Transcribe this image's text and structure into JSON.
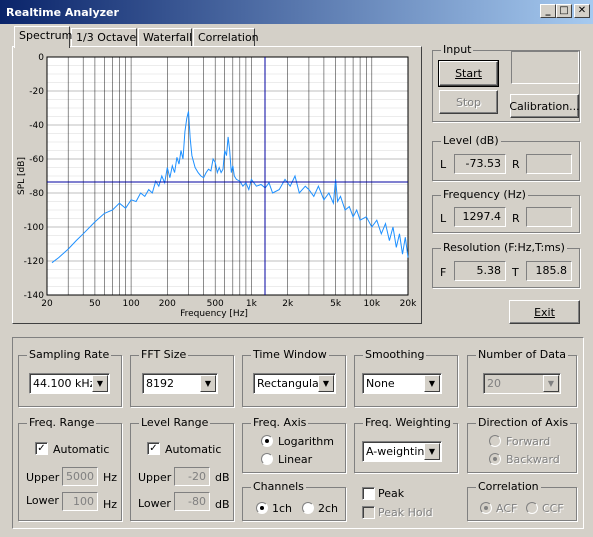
{
  "window": {
    "title": "Realtime Analyzer"
  },
  "title_buttons": {
    "minimize": "_",
    "maximize": "□",
    "close": "✕"
  },
  "tabs": [
    "Spectrum",
    "1/3 Octave",
    "Waterfall",
    "Correlation"
  ],
  "chart_data": {
    "type": "line",
    "title": "",
    "xlabel": "Frequency [Hz]",
    "ylabel": "SPL [dB]",
    "xscale": "log",
    "xlim": [
      20,
      20000
    ],
    "ylim": [
      -140,
      0
    ],
    "xticks": [
      20,
      50,
      100,
      200,
      500,
      1000,
      2000,
      5000,
      10000,
      20000
    ],
    "xtick_labels": [
      "20",
      "50",
      "100",
      "200",
      "500",
      "1k",
      "2k",
      "5k",
      "10k",
      "20k"
    ],
    "yticks": [
      0,
      -20,
      -40,
      -60,
      -80,
      -100,
      -120,
      -140
    ],
    "ytick_labels": [
      "0",
      "-20",
      "-40",
      "-60",
      "-80",
      "-100",
      "-120",
      "-140"
    ],
    "cursor": {
      "x": 1297.4,
      "y": -73.53
    },
    "series": [
      {
        "color": "#1e90ff",
        "x": [
          22,
          25,
          30,
          35,
          40,
          50,
          60,
          70,
          80,
          90,
          100,
          110,
          120,
          130,
          140,
          150,
          160,
          170,
          180,
          190,
          200,
          210,
          220,
          230,
          240,
          250,
          260,
          270,
          280,
          290,
          300,
          310,
          320,
          340,
          360,
          380,
          400,
          420,
          440,
          460,
          480,
          500,
          520,
          540,
          560,
          580,
          600,
          620,
          640,
          660,
          680,
          700,
          720,
          750,
          800,
          850,
          900,
          950,
          1000,
          1100,
          1200,
          1300,
          1400,
          1500,
          1700,
          1900,
          2100,
          2300,
          2500,
          2800,
          3000,
          3300,
          3600,
          4000,
          4400,
          4800,
          5000,
          5200,
          5500,
          6000,
          6500,
          7000,
          7500,
          8000,
          9000,
          10000,
          11000,
          12000,
          13000,
          14000,
          15000,
          16000,
          17000,
          18000,
          19000,
          20000
        ],
        "y": [
          -121,
          -118,
          -113,
          -108,
          -104,
          -97,
          -92,
          -90,
          -86,
          -89,
          -84,
          -85,
          -80,
          -82,
          -78,
          -80,
          -73,
          -76,
          -70,
          -74,
          -65,
          -71,
          -64,
          -68,
          -59,
          -63,
          -55,
          -60,
          -44,
          -36,
          -32,
          -48,
          -58,
          -65,
          -68,
          -70,
          -71,
          -68,
          -66,
          -67,
          -60,
          -62,
          -68,
          -65,
          -68,
          -66,
          -55,
          -58,
          -47,
          -55,
          -68,
          -64,
          -70,
          -72,
          -73,
          -76,
          -74,
          -78,
          -72,
          -76,
          -75,
          -77,
          -74,
          -80,
          -78,
          -72,
          -76,
          -70,
          -80,
          -76,
          -78,
          -82,
          -76,
          -84,
          -80,
          -86,
          -72,
          -85,
          -82,
          -90,
          -88,
          -94,
          -90,
          -96,
          -94,
          -100,
          -96,
          -104,
          -98,
          -108,
          -100,
          -112,
          -104,
          -116,
          -106,
          -118
        ]
      }
    ]
  },
  "input": {
    "title": "Input",
    "start": "Start",
    "stop": "Stop",
    "calibration": "Calibration..."
  },
  "level": {
    "title": "Level (dB)",
    "l_label": "L",
    "l_value": "-73.53",
    "r_label": "R",
    "r_value": ""
  },
  "frequency": {
    "title": "Frequency (Hz)",
    "l_label": "L",
    "l_value": "1297.4",
    "r_label": "R",
    "r_value": ""
  },
  "resolution": {
    "title": "Resolution (F:Hz,T:ms)",
    "f_label": "F",
    "f_value": "5.38",
    "t_label": "T",
    "t_value": "185.8"
  },
  "exit_label": "Exit",
  "sampling_rate": {
    "title": "Sampling Rate",
    "value": "44.100 kHz"
  },
  "fft_size": {
    "title": "FFT Size",
    "value": "8192"
  },
  "time_window": {
    "title": "Time Window",
    "value": "Rectangular"
  },
  "smoothing": {
    "title": "Smoothing",
    "value": "None"
  },
  "number_of_data": {
    "title": "Number of Data",
    "value": "20"
  },
  "freq_range": {
    "title": "Freq. Range",
    "automatic": "Automatic",
    "upper_label": "Upper",
    "upper_value": "5000",
    "lower_label": "Lower",
    "lower_value": "100",
    "unit": "Hz"
  },
  "level_range": {
    "title": "Level Range",
    "automatic": "Automatic",
    "upper_label": "Upper",
    "upper_value": "-20",
    "lower_label": "Lower",
    "lower_value": "-80",
    "unit": "dB"
  },
  "freq_axis": {
    "title": "Freq. Axis",
    "logarithm": "Logarithm",
    "linear": "Linear"
  },
  "freq_weighting": {
    "title": "Freq. Weighting",
    "value": "A-weighting"
  },
  "direction_of_axis": {
    "title": "Direction of Axis",
    "forward": "Forward",
    "backward": "Backward"
  },
  "channels": {
    "title": "Channels",
    "one": "1ch",
    "two": "2ch"
  },
  "peak": {
    "peak": "Peak",
    "peak_hold": "Peak Hold"
  },
  "correlation": {
    "title": "Correlation",
    "acf": "ACF",
    "ccf": "CCF"
  }
}
